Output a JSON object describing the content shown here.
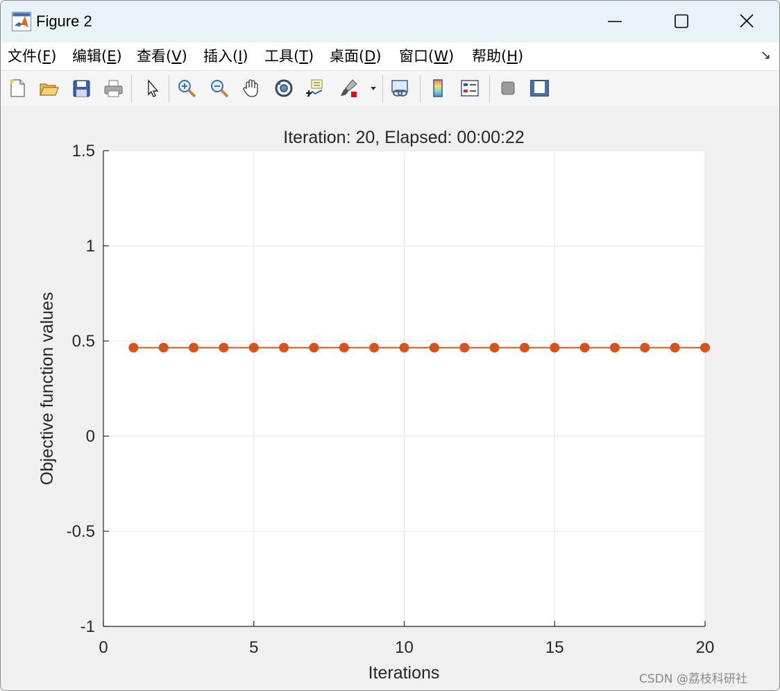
{
  "window": {
    "title": "Figure 2",
    "icon": "matlab-logo-icon"
  },
  "menu": {
    "items": [
      {
        "label": "文件(",
        "key": "F",
        "end": ")"
      },
      {
        "label": "编辑(",
        "key": "E",
        "end": ")"
      },
      {
        "label": "查看(",
        "key": "V",
        "end": ")"
      },
      {
        "label": "插入(",
        "key": "I",
        "end": ")"
      },
      {
        "label": "工具(",
        "key": "T",
        "end": ")"
      },
      {
        "label": "桌面(",
        "key": "D",
        "end": ")"
      },
      {
        "label": "窗口(",
        "key": "W",
        "end": ")"
      },
      {
        "label": "帮助(",
        "key": "H",
        "end": ")"
      }
    ],
    "dock_arrow": "↘"
  },
  "toolbar": {
    "buttons": [
      "new-figure-icon",
      "open-file-icon",
      "save-icon",
      "print-icon",
      "select-arrow-icon",
      "zoom-in-icon",
      "zoom-out-icon",
      "pan-hand-icon",
      "rotate-3d-icon",
      "data-cursor-icon",
      "brush-icon",
      "brush-dropdown-icon",
      "link-plot-icon",
      "colorbar-icon",
      "legend-icon",
      "hide-plot-tools-icon",
      "show-plot-tools-icon"
    ]
  },
  "colors": {
    "series": "#d95319",
    "grid": "#e3e3e3",
    "axis": "#262626"
  },
  "chart_data": {
    "type": "line",
    "title": "Iteration: 20, Elapsed: 00:00:22",
    "xlabel": "Iterations",
    "ylabel": "Objective function values",
    "xlim": [
      0,
      20
    ],
    "ylim": [
      -1,
      1.5
    ],
    "xticks": [
      0,
      5,
      10,
      15,
      20
    ],
    "yticks": [
      -1,
      -0.5,
      0,
      0.5,
      1,
      1.5
    ],
    "xtick_labels": [
      "0",
      "5",
      "10",
      "15",
      "20"
    ],
    "ytick_labels": [
      "-1",
      "-0.5",
      "0",
      "0.5",
      "1",
      "1.5"
    ],
    "grid": true,
    "series": [
      {
        "x": [
          1,
          2,
          3,
          4,
          5,
          6,
          7,
          8,
          9,
          10,
          11,
          12,
          13,
          14,
          15,
          16,
          17,
          18,
          19,
          20
        ],
        "y": [
          0.465,
          0.465,
          0.465,
          0.465,
          0.465,
          0.465,
          0.465,
          0.465,
          0.465,
          0.465,
          0.465,
          0.465,
          0.465,
          0.465,
          0.465,
          0.465,
          0.465,
          0.465,
          0.465,
          0.465
        ],
        "marker": "circle"
      }
    ]
  },
  "watermark": "CSDN @荔枝科研社"
}
